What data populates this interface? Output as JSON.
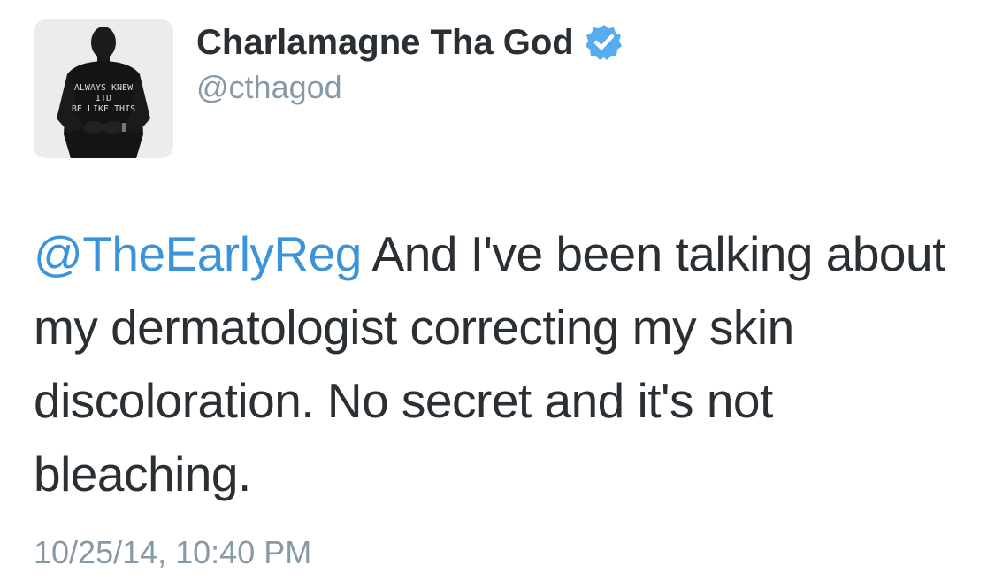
{
  "tweet": {
    "author": {
      "display_name": "Charlamagne Tha God",
      "handle": "@cthagod",
      "verified": true,
      "verified_icon": "verified-badge-icon",
      "avatar_shirt_text": "ALWAYS KNEW IT'D BE LIKE THIS"
    },
    "mention": "@TheEarlyReg",
    "text": " And I've been talking about my dermatologist correcting my skin discoloration. No secret and it's not bleaching.",
    "timestamp": "10/25/14, 10:40 PM"
  },
  "colors": {
    "text": "#292f33",
    "muted": "#8899a6",
    "link": "#3b94d9",
    "verified": "#55acee"
  }
}
